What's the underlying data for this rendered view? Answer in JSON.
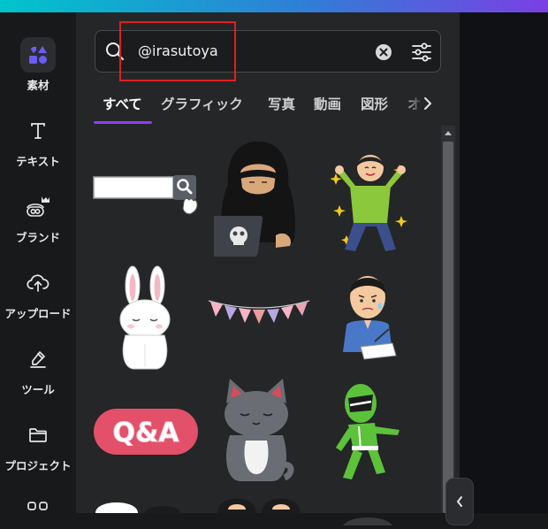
{
  "sidebar": {
    "items": [
      {
        "label": "素材",
        "icon": "elements-shapes-icon",
        "active": true
      },
      {
        "label": "テキスト",
        "icon": "text-t-icon"
      },
      {
        "label": "ブランド",
        "icon": "brand-crown-icon"
      },
      {
        "label": "アップロード",
        "icon": "cloud-upload-icon"
      },
      {
        "label": "ツール",
        "icon": "pen-tool-icon"
      },
      {
        "label": "プロジェクト",
        "icon": "folder-icon"
      }
    ]
  },
  "search": {
    "value": "@irasutoya"
  },
  "tabs": {
    "items": [
      "すべて",
      "グラフィック",
      "写真",
      "動画",
      "図形",
      "オ"
    ]
  },
  "results": {
    "qa_text": "Q&A"
  },
  "colors": {
    "accent": "#8b3dff",
    "highlight": "#e02020",
    "panel": "#252627",
    "sidebar": "#18191b"
  }
}
